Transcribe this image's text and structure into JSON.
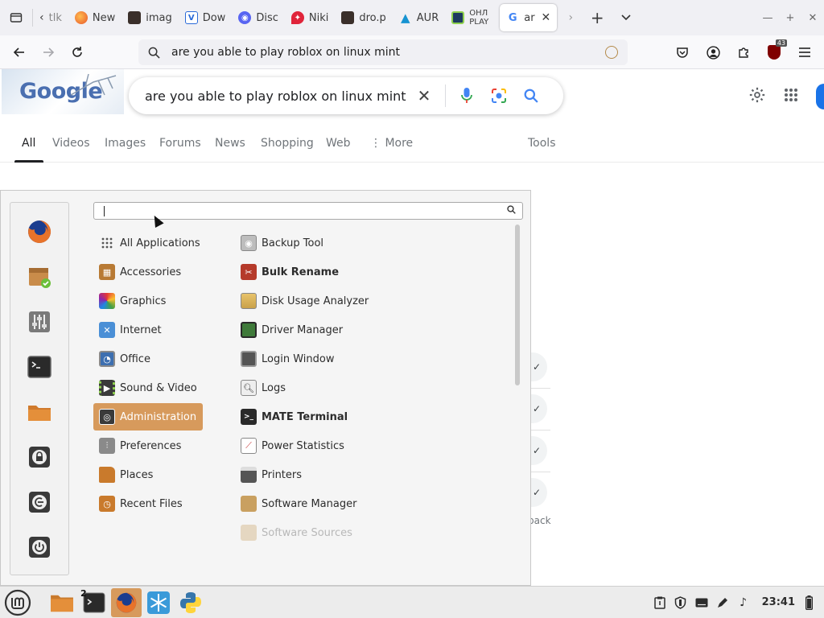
{
  "browser": {
    "tabs": [
      {
        "label": "tlk",
        "icon": "chevron-left-icon"
      },
      {
        "label": "New",
        "icon": "firefox-icon"
      },
      {
        "label": "imag",
        "icon": "page-thumbnail-icon"
      },
      {
        "label": "Dow",
        "icon": "vk-icon"
      },
      {
        "label": "Disc",
        "icon": "discord-icon"
      },
      {
        "label": "Niki",
        "icon": "pinkbox-icon"
      },
      {
        "label": "dro.p",
        "icon": "page-thumbnail-icon"
      },
      {
        "label": "AUR",
        "icon": "arch-icon"
      },
      {
        "label": "ОНЛ PLAY",
        "icon": "game-icon"
      },
      {
        "label": "ar",
        "icon": "google-icon",
        "active": true
      }
    ],
    "url": "are you able to play roblox on linux mint",
    "extension_badge": "43"
  },
  "google": {
    "logo_text": "Google",
    "query": "are you able to play roblox on linux mint",
    "tabs": [
      "All",
      "Videos",
      "Images",
      "Forums",
      "News",
      "Shopping",
      "Web",
      "More",
      "Tools"
    ],
    "active_tab": "All",
    "feedback_fragment": "back"
  },
  "menu": {
    "search_value": "",
    "categories": [
      {
        "label": "All Applications",
        "icon": "grid-icon",
        "color": "#555555"
      },
      {
        "label": "Accessories",
        "icon": "calculator-icon",
        "color": "#b87a34"
      },
      {
        "label": "Graphics",
        "icon": "palette-icon",
        "color": "#7a3fb5"
      },
      {
        "label": "Internet",
        "icon": "globe-icon",
        "color": "#4a8fd6"
      },
      {
        "label": "Office",
        "icon": "office-icon",
        "color": "#3d6fb0"
      },
      {
        "label": "Sound & Video",
        "icon": "film-icon",
        "color": "#3a3a3a"
      },
      {
        "label": "Administration",
        "icon": "admin-icon",
        "color": "#3a3a3a",
        "selected": true
      },
      {
        "label": "Preferences",
        "icon": "sliders-icon",
        "color": "#8a8a8a"
      },
      {
        "label": "Places",
        "icon": "folder-icon",
        "color": "#c97a2c"
      },
      {
        "label": "Recent Files",
        "icon": "recent-folder-icon",
        "color": "#c97a2c"
      }
    ],
    "apps": [
      {
        "label": "Backup Tool",
        "icon": "backup-icon",
        "color": "#9a9a9a"
      },
      {
        "label": "Bulk Rename",
        "icon": "bulk-rename-icon",
        "color": "#b53a2a",
        "bold": true
      },
      {
        "label": "Disk Usage Analyzer",
        "icon": "disk-usage-icon",
        "color": "#c9a14a"
      },
      {
        "label": "Driver Manager",
        "icon": "driver-icon",
        "color": "#3f7a3a"
      },
      {
        "label": "Login Window",
        "icon": "login-icon",
        "color": "#555555"
      },
      {
        "label": "Logs",
        "icon": "logs-icon",
        "color": "#888888"
      },
      {
        "label": "MATE Terminal",
        "icon": "terminal-icon",
        "color": "#2a2a2a",
        "bold": true
      },
      {
        "label": "Power Statistics",
        "icon": "power-stats-icon",
        "color": "#c94040"
      },
      {
        "label": "Printers",
        "icon": "printer-icon",
        "color": "#555555"
      },
      {
        "label": "Software Manager",
        "icon": "software-manager-icon",
        "color": "#c9a060"
      },
      {
        "label": "Software Sources",
        "icon": "software-sources-icon",
        "color": "#c9a060",
        "faded": true
      }
    ],
    "favorites": [
      {
        "name": "firefox-icon",
        "color": "#e66a1f"
      },
      {
        "name": "software-manager-icon",
        "color": "#c98c4a"
      },
      {
        "name": "settings-sliders-icon",
        "color": "#7a7a7a"
      },
      {
        "name": "terminal-icon",
        "color": "#2a2a2a"
      },
      {
        "name": "folder-icon",
        "color": "#d07a2c"
      },
      {
        "name": "lock-icon",
        "color": "#3a3a3a"
      },
      {
        "name": "logout-icon",
        "color": "#3a3a3a"
      },
      {
        "name": "power-icon",
        "color": "#3a3a3a"
      }
    ],
    "selected_color": "#d79a5c"
  },
  "taskbar": {
    "terminal_badge": "2",
    "clock": "23:41",
    "tray_icons": [
      "clipboard-icon",
      "shield-icon",
      "keyboard-icon",
      "pen-icon",
      "music-icon",
      "battery-icon"
    ]
  }
}
